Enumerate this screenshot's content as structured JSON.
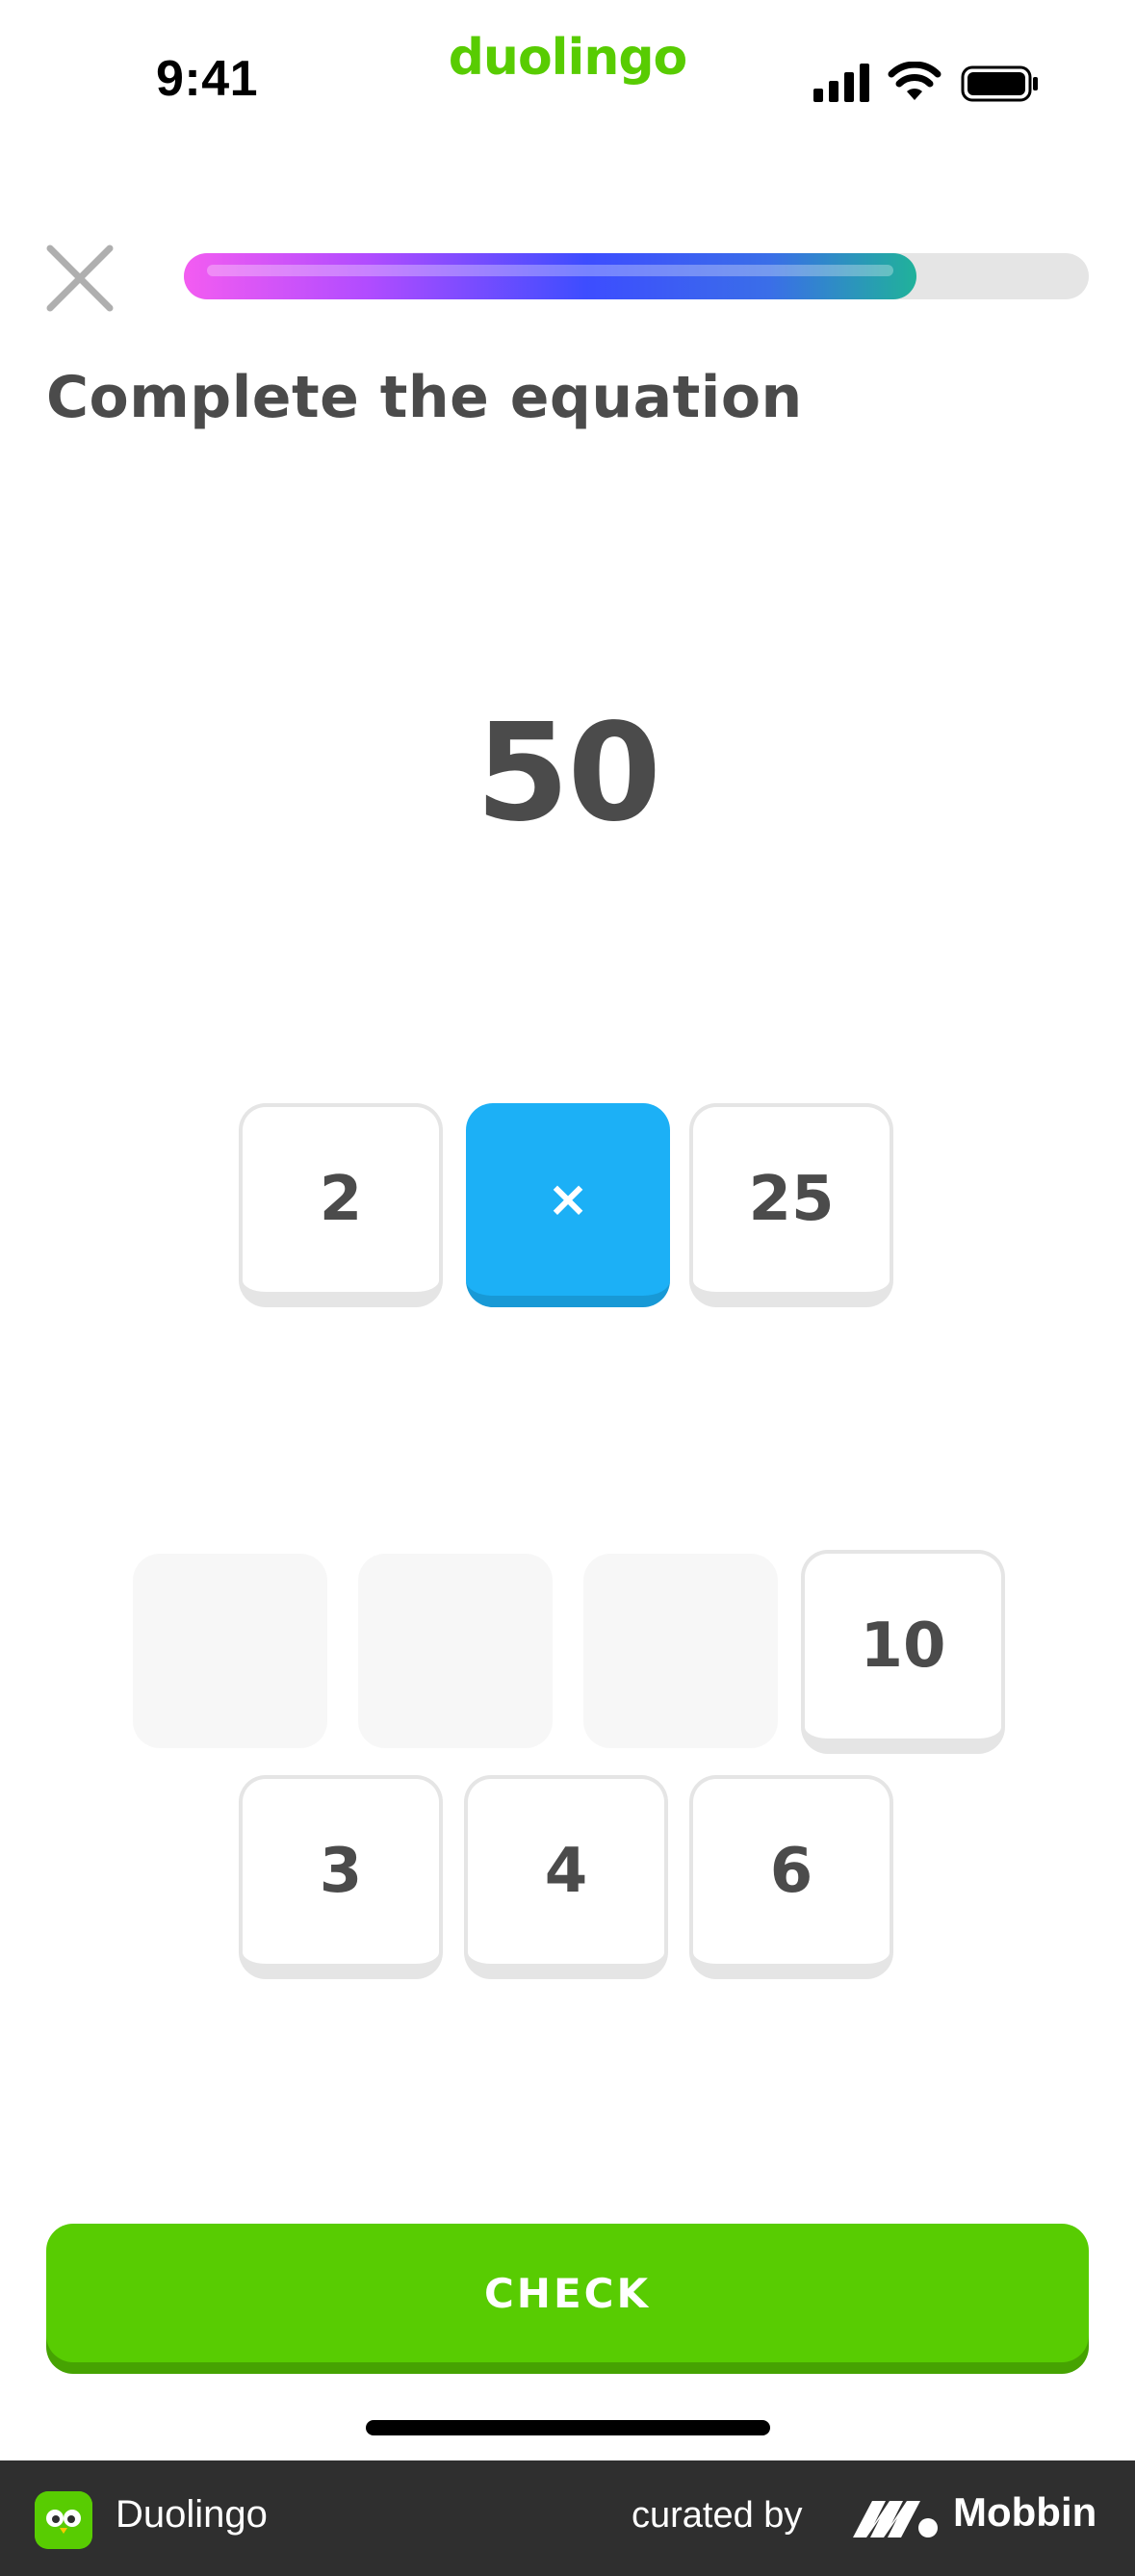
{
  "status_bar": {
    "time": "9:41"
  },
  "brand": {
    "name": "duolingo"
  },
  "lesson": {
    "progress_fraction": 0.81,
    "prompt": "Complete the equation",
    "target_value": "50",
    "equation": {
      "left": "2",
      "operator": "×",
      "right": "25"
    },
    "word_bank": {
      "row1_remaining": "10",
      "row2": [
        "3",
        "4",
        "6"
      ]
    }
  },
  "actions": {
    "check_label": "CHECK"
  },
  "footer": {
    "app_name": "Duolingo",
    "curated_by": "curated by",
    "mobbin": "Mobbin"
  },
  "colors": {
    "brand_green": "#58cc02",
    "operator_blue": "#1cb0f6",
    "text": "#4b4b4b"
  }
}
